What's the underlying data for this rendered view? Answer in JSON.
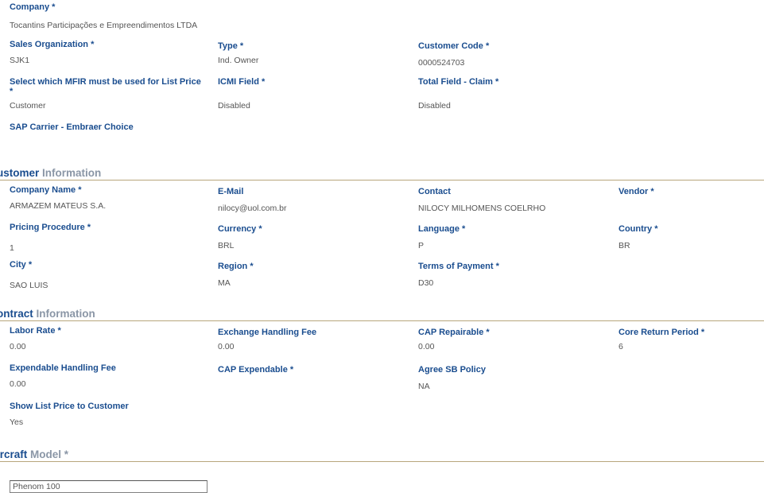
{
  "top": {
    "company": {
      "label": "Company *",
      "value": "Tocantins Participações e Empreendimentos LTDA"
    },
    "sales_org": {
      "label": "Sales Organization *",
      "value": "SJK1"
    },
    "type": {
      "label": "Type *",
      "value": "Ind. Owner"
    },
    "customer_code": {
      "label": "Customer Code *",
      "value": "0000524703"
    },
    "mfir": {
      "label_line1": "Select which MFIR must be used for List Price",
      "label_line2": "*",
      "value": "Customer"
    },
    "icmi": {
      "label": "ICMI Field *",
      "value": "Disabled"
    },
    "total_field": {
      "label": "Total Field - Claim *",
      "value": "Disabled"
    },
    "sap_carrier": {
      "label": "SAP Carrier - Embraer Choice",
      "value": ""
    }
  },
  "customer_section": {
    "title_dark": "ustomer",
    "title_light": "Information",
    "company_name": {
      "label": "Company Name *",
      "value": "ARMAZEM MATEUS S.A."
    },
    "email": {
      "label": "E-Mail",
      "value": "nilocy@uol.com.br"
    },
    "contact": {
      "label": "Contact",
      "value": "NILOCY MILHOMENS COELRHO"
    },
    "vendor": {
      "label": "Vendor *",
      "value": ""
    },
    "pricing_procedure": {
      "label": "Pricing Procedure *",
      "value": "1"
    },
    "currency": {
      "label": "Currency *",
      "value": "BRL"
    },
    "language": {
      "label": "Language *",
      "value": "P"
    },
    "country": {
      "label": "Country *",
      "value": "BR"
    },
    "city": {
      "label": "City *",
      "value": "SAO LUIS"
    },
    "region": {
      "label": "Region *",
      "value": "MA"
    },
    "terms_of_payment": {
      "label": "Terms of Payment *",
      "value": "D30"
    }
  },
  "contract_section": {
    "title_dark": "ontract",
    "title_light": "Information",
    "labor_rate": {
      "label": "Labor Rate *",
      "value": "0.00"
    },
    "exchange_handling_fee": {
      "label": "Exchange Handling Fee",
      "value": "0.00"
    },
    "cap_repairable": {
      "label": "CAP Repairable *",
      "value": "0.00"
    },
    "core_return_period": {
      "label": "Core Return Period *",
      "value": "6"
    },
    "expendable_handling_fee": {
      "label": "Expendable Handling Fee",
      "value": "0.00"
    },
    "cap_expendable": {
      "label": "CAP Expendable *",
      "value": ""
    },
    "agree_sb_policy": {
      "label": "Agree SB Policy",
      "value": "NA"
    },
    "show_list_price": {
      "label": "Show List Price to Customer",
      "value": "Yes"
    }
  },
  "aircraft_section": {
    "title_dark": "ircraft",
    "title_light": "Model *",
    "model_input_value": "Phenom 100"
  },
  "colors": {
    "label": "#1a4d8f",
    "value": "#555555",
    "rule": "#b8a67c",
    "section_light": "#8a96a6"
  }
}
